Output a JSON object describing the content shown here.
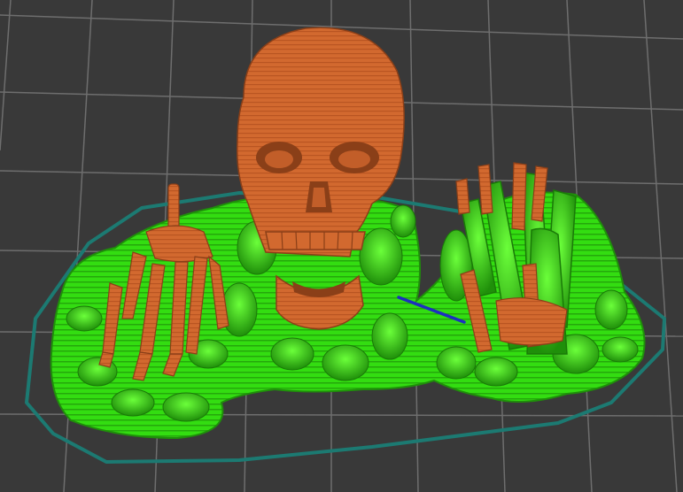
{
  "app": {
    "view": "slicer-layer-preview"
  },
  "colors": {
    "background": "#393939",
    "grid": "#6e6e6e",
    "skirt": "#1c7a72",
    "support": "#33dd11",
    "support_dark": "#1f8f0a",
    "model": "#d2692f",
    "model_dark": "#8a3f18",
    "travel": "#1d2fbf"
  },
  "legend_items": [
    {
      "name": "model-walls",
      "color": "#d2692f"
    },
    {
      "name": "support-material",
      "color": "#33dd11"
    },
    {
      "name": "skirt",
      "color": "#1c7a72"
    },
    {
      "name": "travel-move",
      "color": "#1d2fbf"
    }
  ]
}
